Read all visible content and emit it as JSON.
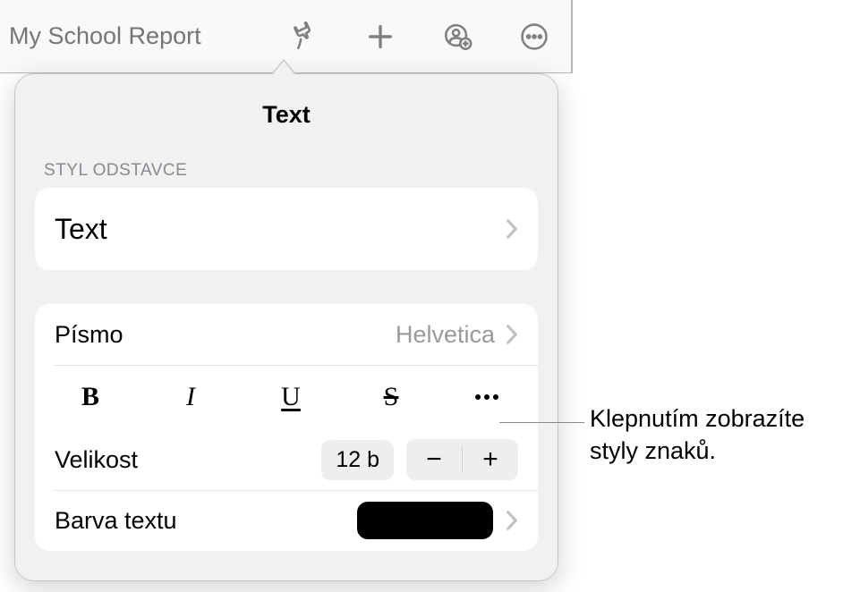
{
  "toolbar": {
    "doc_title": "My School Report"
  },
  "popover": {
    "title": "Text",
    "section_paragraph_style": "STYL ODSTAVCE",
    "paragraph_style_value": "Text",
    "font": {
      "label": "Písmo",
      "value": "Helvetica"
    },
    "styles": {
      "bold": "B",
      "italic": "I",
      "underline": "U",
      "strike": "S"
    },
    "size": {
      "label": "Velikost",
      "value": "12 b",
      "minus": "−",
      "plus": "+"
    },
    "text_color": {
      "label": "Barva textu",
      "color": "#000000"
    }
  },
  "callout": {
    "line1": "Klepnutím zobrazíte",
    "line2": "styly znaků."
  }
}
